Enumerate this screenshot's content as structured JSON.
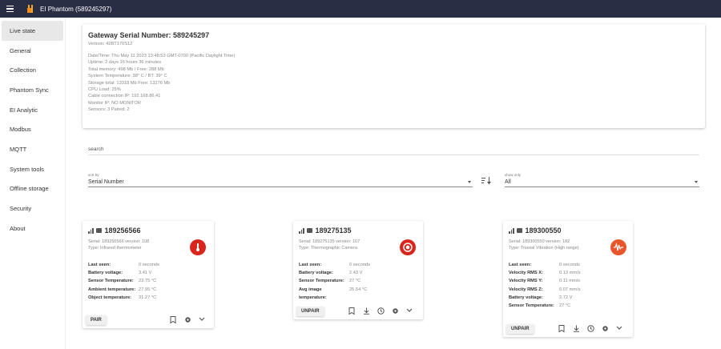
{
  "app": {
    "title": "EI Phantom (589245297)",
    "header_bg": "#2a2e45"
  },
  "sidebar": {
    "items": [
      {
        "label": "Live state",
        "active": true
      },
      {
        "label": "General"
      },
      {
        "label": "Collection"
      },
      {
        "label": "Phantom Sync"
      },
      {
        "label": "EI Analytic"
      },
      {
        "label": "Modbus"
      },
      {
        "label": "MQTT"
      },
      {
        "label": "System tools"
      },
      {
        "label": "Offline storage"
      },
      {
        "label": "Security"
      },
      {
        "label": "About"
      }
    ]
  },
  "gateway": {
    "title": "Gateway Serial Number: 589245297",
    "version": "Version: 42BT170S12",
    "lines": [
      "Date/Time: Thu May 11 2023 13:48:53 GMT-0700 (Pacific Daylight Time)",
      "Uptime: 2 days 16 hours 36 minutes",
      "Total memory: 498 Mb / Free: 288 Mb",
      "System Temperature: 38° C / BT: 39° C",
      "Storage total: 13318 Mb Free: 13276 Mb",
      "CPU Load: 25%",
      "Cable connection IP: 192.168.86.41",
      "Monitor IP: NO MONITOR",
      "Sensors: 3 Paired: 2"
    ]
  },
  "search": {
    "placeholder": "search"
  },
  "sort": {
    "label": "sort by",
    "value": "Serial Number"
  },
  "show": {
    "label": "show only",
    "value": "All"
  },
  "sensors": [
    {
      "id": "189256566",
      "serial_line": "Serial: 189256566 version: 108",
      "type_line": "Type: Infrared thermometer",
      "icon": "thermometer-icon",
      "icon_color": "#d9261c",
      "rows": [
        {
          "k": "Last seen:",
          "v": "0 seconds"
        },
        {
          "k": "Battery voltage:",
          "v": "3.41 V"
        },
        {
          "k": "Sensor Temperature:",
          "v": "23.75 °C"
        },
        {
          "k": "Ambient temperature:",
          "v": "27.95 °C"
        },
        {
          "k": "Object temperature:",
          "v": "31.27 °C"
        }
      ],
      "button": "PAIR"
    },
    {
      "id": "189275135",
      "serial_line": "Serial: 189275135 version: 107",
      "type_line": "Type: Thermographic Camera",
      "icon": "camera-target-icon",
      "icon_color": "#d9261c",
      "rows": [
        {
          "k": "Last seen:",
          "v": "0 seconds"
        },
        {
          "k": "Battery voltage:",
          "v": "2.43 V"
        },
        {
          "k": "Sensor Temperature:",
          "v": "27 °C"
        },
        {
          "k": "Avg image temperature:",
          "v": "25.54 °C"
        }
      ],
      "button": "UNPAIR"
    },
    {
      "id": "189300550",
      "serial_line": "Serial: 189300550 version: 182",
      "type_line": "Type: Triaxial Vibration (High range)",
      "icon": "vibration-icon",
      "icon_color": "#e8552a",
      "rows": [
        {
          "k": "Last seen:",
          "v": "0 seconds"
        },
        {
          "k": "Velocity RMS X:",
          "v": "0.13 mm/s"
        },
        {
          "k": "Velocity RMS Y:",
          "v": "0.11 mm/s"
        },
        {
          "k": "Velocity RMS Z:",
          "v": "0.07 mm/s"
        },
        {
          "k": "Battery voltage:",
          "v": "2.72 V"
        },
        {
          "k": "Sensor Temperature:",
          "v": "27 °C"
        }
      ],
      "button": "UNPAIR"
    }
  ]
}
